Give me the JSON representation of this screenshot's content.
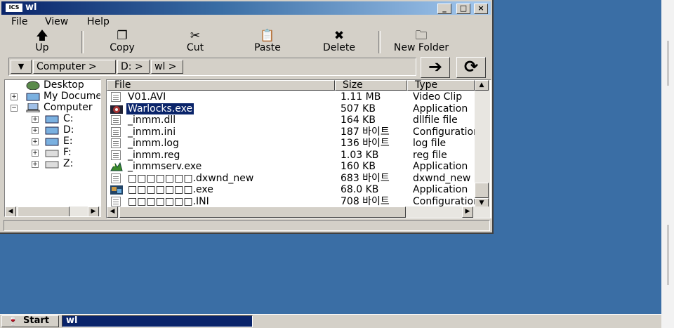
{
  "window": {
    "title": "wl",
    "app_icon_text": "ICS",
    "controls": {
      "minimize": "_",
      "maximize": "□",
      "close": "×"
    }
  },
  "menu": [
    "File",
    "View",
    "Help"
  ],
  "toolbar": [
    {
      "label": "Up",
      "icon": "up-arrow-icon"
    },
    {
      "label": "Copy",
      "icon": "copy-icon"
    },
    {
      "label": "Cut",
      "icon": "scissors-icon"
    },
    {
      "label": "Paste",
      "icon": "paste-icon"
    },
    {
      "label": "Delete",
      "icon": "x-icon"
    },
    {
      "label": "New Folder",
      "icon": "new-folder-icon"
    }
  ],
  "address": {
    "crumbs": [
      "Computer >",
      "D: >",
      "wl >"
    ]
  },
  "tree": {
    "items": [
      "Desktop",
      "My Documents",
      "Computer",
      "C:",
      "D:",
      "E:",
      "F:",
      "Z:"
    ]
  },
  "list": {
    "columns": [
      "File",
      "Size",
      "Type"
    ],
    "rows": [
      {
        "name": "V01.AVI",
        "size": "1.11 MB",
        "type": "Video Clip",
        "icon": "doc"
      },
      {
        "name": "Warlocks.exe",
        "size": "507 KB",
        "type": "Application",
        "icon": "warlocks",
        "selected": true
      },
      {
        "name": "_inmm.dll",
        "size": "164 KB",
        "type": "dllfile file",
        "icon": "doc"
      },
      {
        "name": "_inmm.ini",
        "size": "187 바이트",
        "type": "Configuration",
        "icon": "doc"
      },
      {
        "name": "_inmm.log",
        "size": "136 바이트",
        "type": "log file",
        "icon": "doc"
      },
      {
        "name": "_inmm.reg",
        "size": "1.03 KB",
        "type": "reg file",
        "icon": "doc"
      },
      {
        "name": "_inmmserv.exe",
        "size": "160 KB",
        "type": "Application",
        "icon": "inmmserv"
      },
      {
        "name": "□□□□□□□.dxwnd_new",
        "size": "683 바이트",
        "type": "dxwnd_new",
        "icon": "doc"
      },
      {
        "name": "□□□□□□□.exe",
        "size": "68.0 KB",
        "type": "Application",
        "icon": "game"
      },
      {
        "name": "□□□□□□□.INI",
        "size": "708 바이트",
        "type": "Configuration",
        "icon": "doc"
      }
    ]
  },
  "taskbar": {
    "start_label": "Start",
    "task_label": "wl"
  },
  "colors": {
    "desktop": "#3a6ea5",
    "title_active": "#0a246a",
    "face": "#d4d0c8",
    "selection": "#0a246a"
  }
}
